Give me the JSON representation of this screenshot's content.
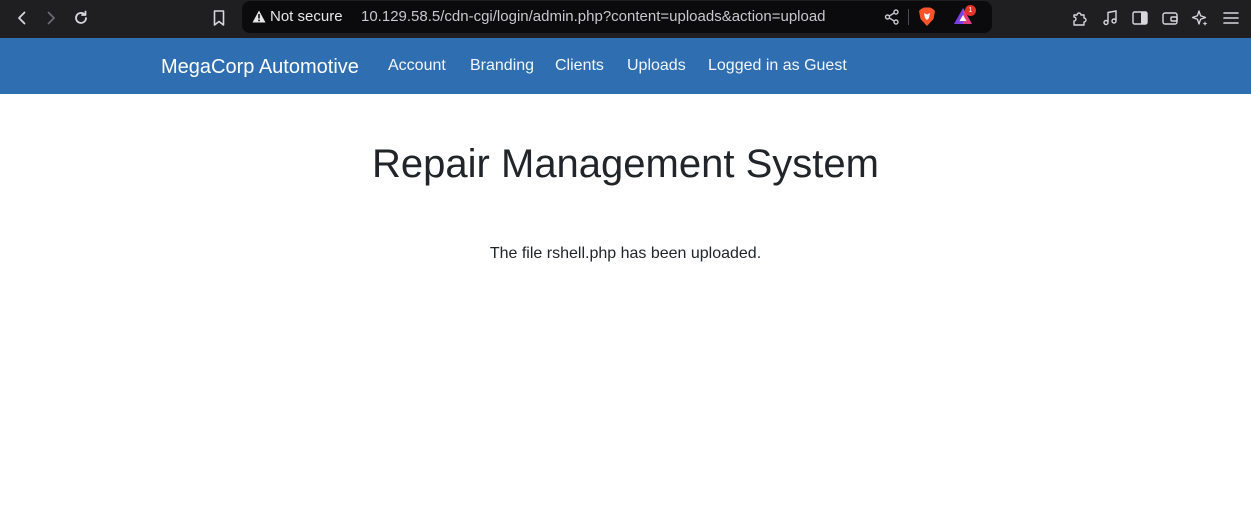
{
  "browser": {
    "security_label": "Not secure",
    "url": "10.129.58.5/cdn-cgi/login/admin.php?content=uploads&action=upload",
    "rewards_badge": "1"
  },
  "navbar": {
    "brand": "MegaCorp Automotive",
    "links": [
      "Account",
      "Branding",
      "Clients",
      "Uploads",
      "Logged in as Guest"
    ]
  },
  "main": {
    "title": "Repair Management System",
    "message": "The file rshell.php has been uploaded."
  },
  "colors": {
    "navbar_bg": "#2f6eb0",
    "chrome_bg": "#1f1f22",
    "text": "#212529"
  }
}
